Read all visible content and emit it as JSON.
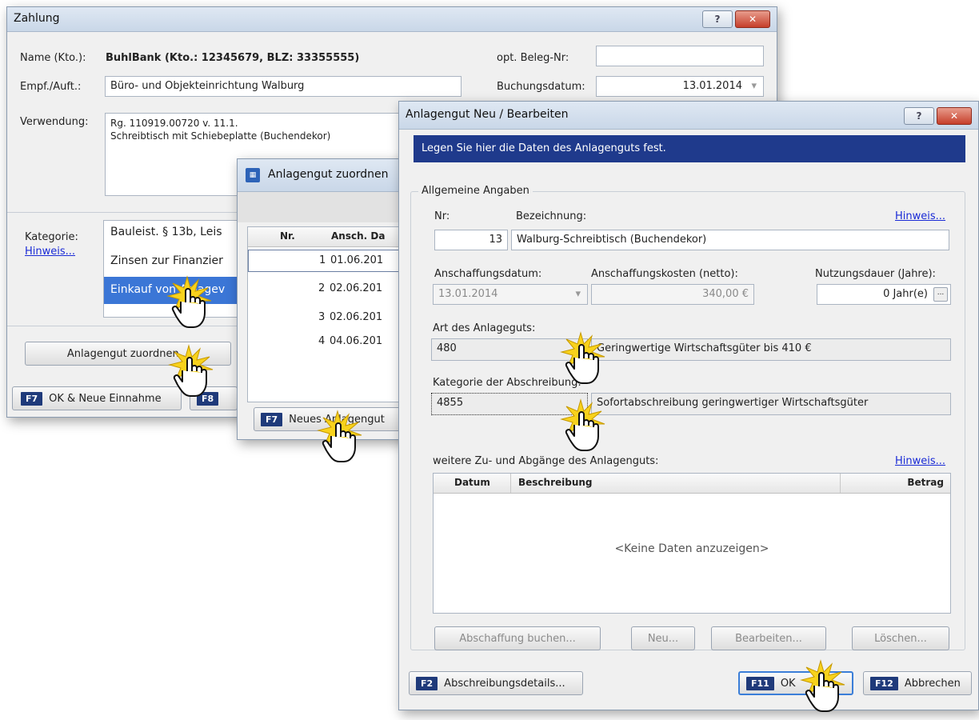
{
  "zahlung": {
    "title": "Zahlung",
    "help_btn": "?",
    "close_btn": "✕",
    "name_label": "Name (Kto.):",
    "name_value": "BuhlBank (Kto.: 12345679, BLZ: 33355555)",
    "empf_label": "Empf./Auft.:",
    "empf_value": "Büro- und Objekteinrichtung Walburg",
    "beleg_label": "opt. Beleg-Nr:",
    "beleg_value": "",
    "buchung_label": "Buchungsdatum:",
    "buchung_value": "13.01.2014",
    "verwendung_label": "Verwendung:",
    "verwendung_line1": "Rg. 110919.00720 v. 11.1.",
    "verwendung_line2": "Schreibtisch mit Schiebeplatte (Buchendekor)",
    "kategorie_label": "Kategorie:",
    "hinweis": "Hinweis...",
    "categories": [
      "Bauleist. § 13b, Leis",
      "Zinsen zur Finanzier",
      "Einkauf von Anlagev"
    ],
    "assign_button": "Anlagengut zuordnen...",
    "f7_key": "F7",
    "f7_label": "OK & Neue Einnahme",
    "f8_key": "F8"
  },
  "zuordnen": {
    "title": "Anlagengut zuordnen",
    "col_nr": "Nr.",
    "col_date": "Ansch. Da",
    "rows": [
      {
        "nr": "1",
        "date": "01.06.201"
      },
      {
        "nr": "2",
        "date": "02.06.201"
      },
      {
        "nr": "3",
        "date": "02.06.201"
      },
      {
        "nr": "4",
        "date": "04.06.201"
      }
    ],
    "f7_key": "F7",
    "f7_label": "Neues Anlagengut"
  },
  "anlagengut": {
    "title": "Anlagengut Neu / Bearbeiten",
    "help_btn": "?",
    "close_btn": "✕",
    "banner": "Legen Sie hier die Daten des Anlagenguts fest.",
    "group_title": "Allgemeine Angaben",
    "nr_label": "Nr:",
    "nr_value": "13",
    "bez_label": "Bezeichnung:",
    "bez_value": "Walburg-Schreibtisch (Buchendekor)",
    "hinweis": "Hinweis...",
    "anschaffungsdatum_label": "Anschaffungsdatum:",
    "anschaffungsdatum_value": "13.01.2014",
    "kosten_label": "Anschaffungskosten (netto):",
    "kosten_value": "340,00 €",
    "nutzung_label": "Nutzungsdauer (Jahre):",
    "nutzung_value": "0 Jahr(e)",
    "ellipsis": "...",
    "art_label": "Art des Anlageguts:",
    "art_code": "480",
    "art_desc": "Geringwertige Wirtschaftsgüter bis 410 €",
    "kat_label": "Kategorie der Abschreibung:",
    "kat_code": "4855",
    "kat_desc": "Sofortabschreibung geringwertiger Wirtschaftsgüter",
    "weitere_label": "weitere Zu- und Abgänge des Anlagenguts:",
    "col_datum": "Datum",
    "col_beschreibung": "Beschreibung",
    "col_betrag": "Betrag",
    "empty_text": "<Keine Daten anzuzeigen>",
    "btn_abschaffung": "Abschaffung buchen...",
    "btn_neu": "Neu...",
    "btn_bearbeiten": "Bearbeiten...",
    "btn_loeschen": "Löschen...",
    "f2_key": "F2",
    "f2_label": "Abschreibungsdetails...",
    "f11_key": "F11",
    "f11_label": "OK",
    "f12_key": "F12",
    "f12_label": "Abbrechen"
  },
  "colors": {
    "banner_bg": "#1f3a8c",
    "fkey_bg": "#1f3a7a",
    "selection_bg": "#3b76d6",
    "link": "#1a2bd6"
  }
}
